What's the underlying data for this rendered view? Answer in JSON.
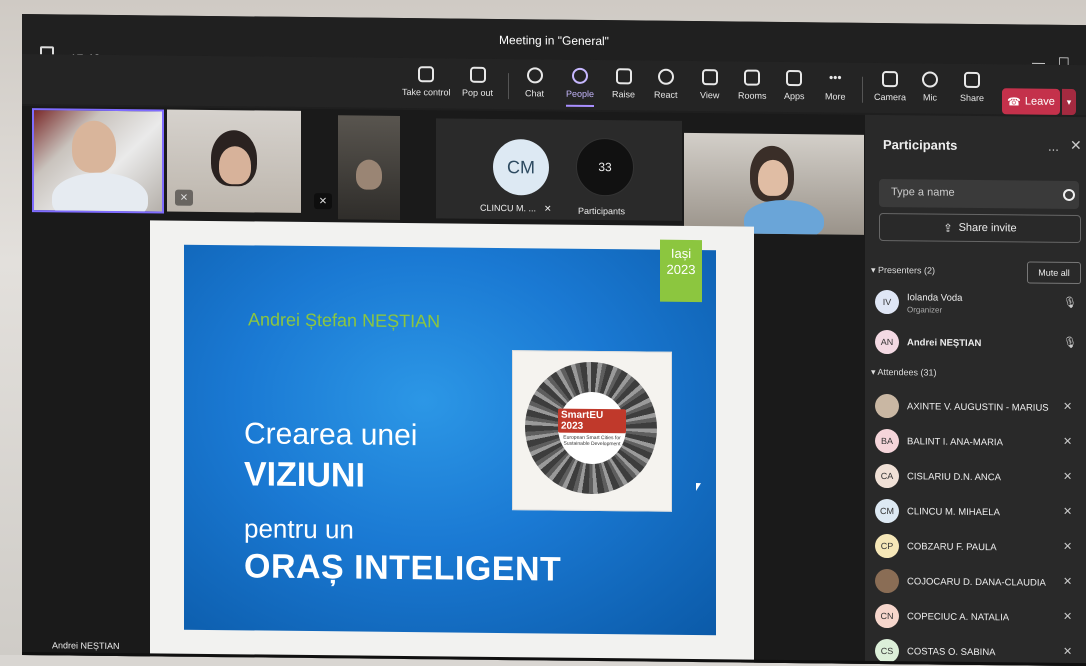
{
  "window": {
    "title": "Meeting in \"General\"",
    "time": "17:46",
    "minimize": "—",
    "maximize": "☐"
  },
  "toolbar": {
    "take_control": "Take control",
    "pop_out": "Pop out",
    "chat": "Chat",
    "people": "People",
    "raise": "Raise",
    "react": "React",
    "view": "View",
    "rooms": "Rooms",
    "apps": "Apps",
    "more": "More",
    "camera": "Camera",
    "mic": "Mic",
    "share": "Share",
    "leave": "Leave"
  },
  "stage": {
    "avatar_initials": "CM",
    "avatar_name": "CLINCU M. ...",
    "participant_count": "33",
    "participants_label": "Participants",
    "presenter_name": "Andrei NEȘTIAN"
  },
  "slide": {
    "badge_line1": "Iași",
    "badge_line2": "2023",
    "author": "Andrei Ștefan NEȘTIAN",
    "line1": "Crearea unei",
    "line2": "VIZIUNI",
    "line3": "pentru un",
    "line4": "ORAȘ INTELIGENT",
    "poster_title": "SmartEU 2023",
    "poster_sub": "European Smart Cities for Sustainable Development"
  },
  "panel": {
    "title": "Participants",
    "more": "...",
    "close": "✕",
    "search_placeholder": "Type a name",
    "share_invite": "Share invite",
    "presenters_label": "▾ Presenters (2)",
    "mute_all": "Mute all",
    "attendees_label": "▾ Attendees (31)",
    "presenters": [
      {
        "initials": "IV",
        "name": "Iolanda Voda",
        "role": "Organizer",
        "color": "#dfe6f5"
      },
      {
        "initials": "AN",
        "name": "Andrei NEȘTIAN",
        "role": "",
        "color": "#f3d9e3"
      }
    ],
    "attendees": [
      {
        "initials": "",
        "name": "AXINTE V. AUGUSTIN - MARIUS",
        "color": "#c9b7a3"
      },
      {
        "initials": "BA",
        "name": "BALINT I. ANA-MARIA",
        "color": "#f5d5da"
      },
      {
        "initials": "CA",
        "name": "CISLARIU D.N. ANCA",
        "color": "#f0e0d6"
      },
      {
        "initials": "CM",
        "name": "CLINCU M. MIHAELA",
        "color": "#dde9f3"
      },
      {
        "initials": "CP",
        "name": "COBZARU F. PAULA",
        "color": "#f6e7b8"
      },
      {
        "initials": "",
        "name": "COJOCARU D. DANA-CLAUDIA",
        "color": "#8a6d55"
      },
      {
        "initials": "CN",
        "name": "COPECIUC A. NATALIA",
        "color": "#f6d6cc"
      },
      {
        "initials": "CS",
        "name": "COSTAS O. SABINA",
        "color": "#dcefd9"
      }
    ]
  }
}
